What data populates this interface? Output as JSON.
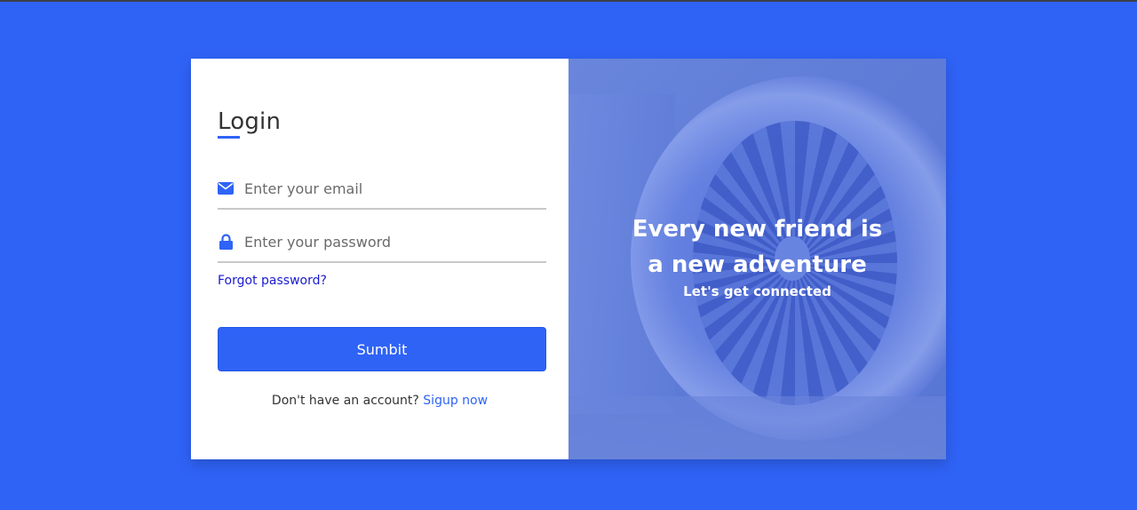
{
  "colors": {
    "background": "#2f63f6",
    "accent": "#2f63f6",
    "link": "#1a1ad0",
    "card": "#ffffff"
  },
  "login": {
    "title": "Login",
    "email": {
      "icon": "envelope-icon",
      "placeholder": "Enter your email",
      "value": ""
    },
    "password": {
      "icon": "lock-icon",
      "placeholder": "Enter your password",
      "value": ""
    },
    "forgot_label": "Forgot password?",
    "submit_label": "Sumbit",
    "signup_prompt": "Don't have an account?",
    "signup_link": "Sigup now"
  },
  "promo": {
    "headline": "Every new friend is a new adventure",
    "subline": "Let's get connected"
  }
}
